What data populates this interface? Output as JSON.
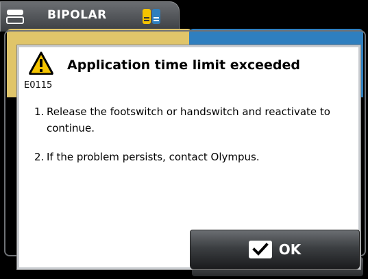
{
  "header": {
    "mode_title": "BIPOLAR",
    "mode_icon": "bipolar-device-icon",
    "indicator_icon": "bipolar-indicator-icon"
  },
  "dialog": {
    "icon": "warning-icon",
    "error_code": "E0115",
    "title": "Application time limit exceeded",
    "items": [
      {
        "num": "1.",
        "text": "Release the footswitch or handswitch and reactivate to continue."
      },
      {
        "num": "2.",
        "text": "If the problem persists, contact Olympus."
      }
    ],
    "ok_button": {
      "label": "OK",
      "icon": "checkmark-icon"
    }
  },
  "colors": {
    "warning_yellow": "#f5c400",
    "yellow_channel": "#e0c56a",
    "blue_channel": "#2f7fbf"
  }
}
